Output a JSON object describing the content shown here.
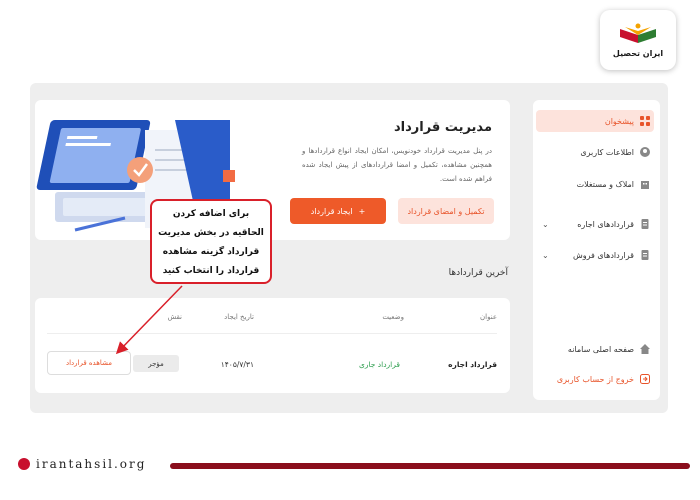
{
  "brand": {
    "logo_text": "ایران تحصیل",
    "footer_url": "irantahsil.org"
  },
  "sidebar": {
    "items": [
      {
        "label": "پیشخوان",
        "icon": "dashboard-icon",
        "active": true
      },
      {
        "label": "اطلاعات کاربری",
        "icon": "user-icon"
      },
      {
        "label": "املاک و مستغلات",
        "icon": "building-icon"
      },
      {
        "label": "قراردادهای اجاره",
        "icon": "contract-icon",
        "expandable": true
      },
      {
        "label": "قراردادهای فروش",
        "icon": "contract-icon",
        "expandable": true
      }
    ],
    "bottom": [
      {
        "label": "صفحه اصلی سامانه",
        "icon": "home-icon"
      },
      {
        "label": "خروج از حساب کاربری",
        "icon": "logout-icon"
      }
    ]
  },
  "main": {
    "title": "مدیریت قرارداد",
    "description": "در پنل مدیریت قرارداد خودنویس، امکان ایجاد انواع قراردادها و همچنین مشاهده، تکمیل و امضا قراردادهای از پیش ایجاد شده فراهم شده است.",
    "btn_create": "ایجاد قرارداد",
    "btn_create_icon": "+",
    "btn_complete": "تکمیل و امضای قرارداد"
  },
  "recent": {
    "title": "آخرین قراردادها",
    "columns": [
      "عنوان",
      "وضعیت",
      "تاریخ ایجاد",
      "نقش"
    ],
    "row": {
      "title": "قرارداد اجاره",
      "status": "قرارداد جاری",
      "date": "۱۴۰۵/۷/۳۱",
      "role": "مؤجر",
      "action": "مشاهده قرارداد"
    }
  },
  "callout": {
    "text": "برای اضافه کردن الحاقیه در بخش مدیریت قرارداد گزینه مشاهده قرارداد را انتخاب کنید"
  },
  "colors": {
    "accent": "#ee5a29",
    "accent_light": "#fde3dc",
    "callout_border": "#d9202a",
    "status_green": "#2e9e4f"
  }
}
